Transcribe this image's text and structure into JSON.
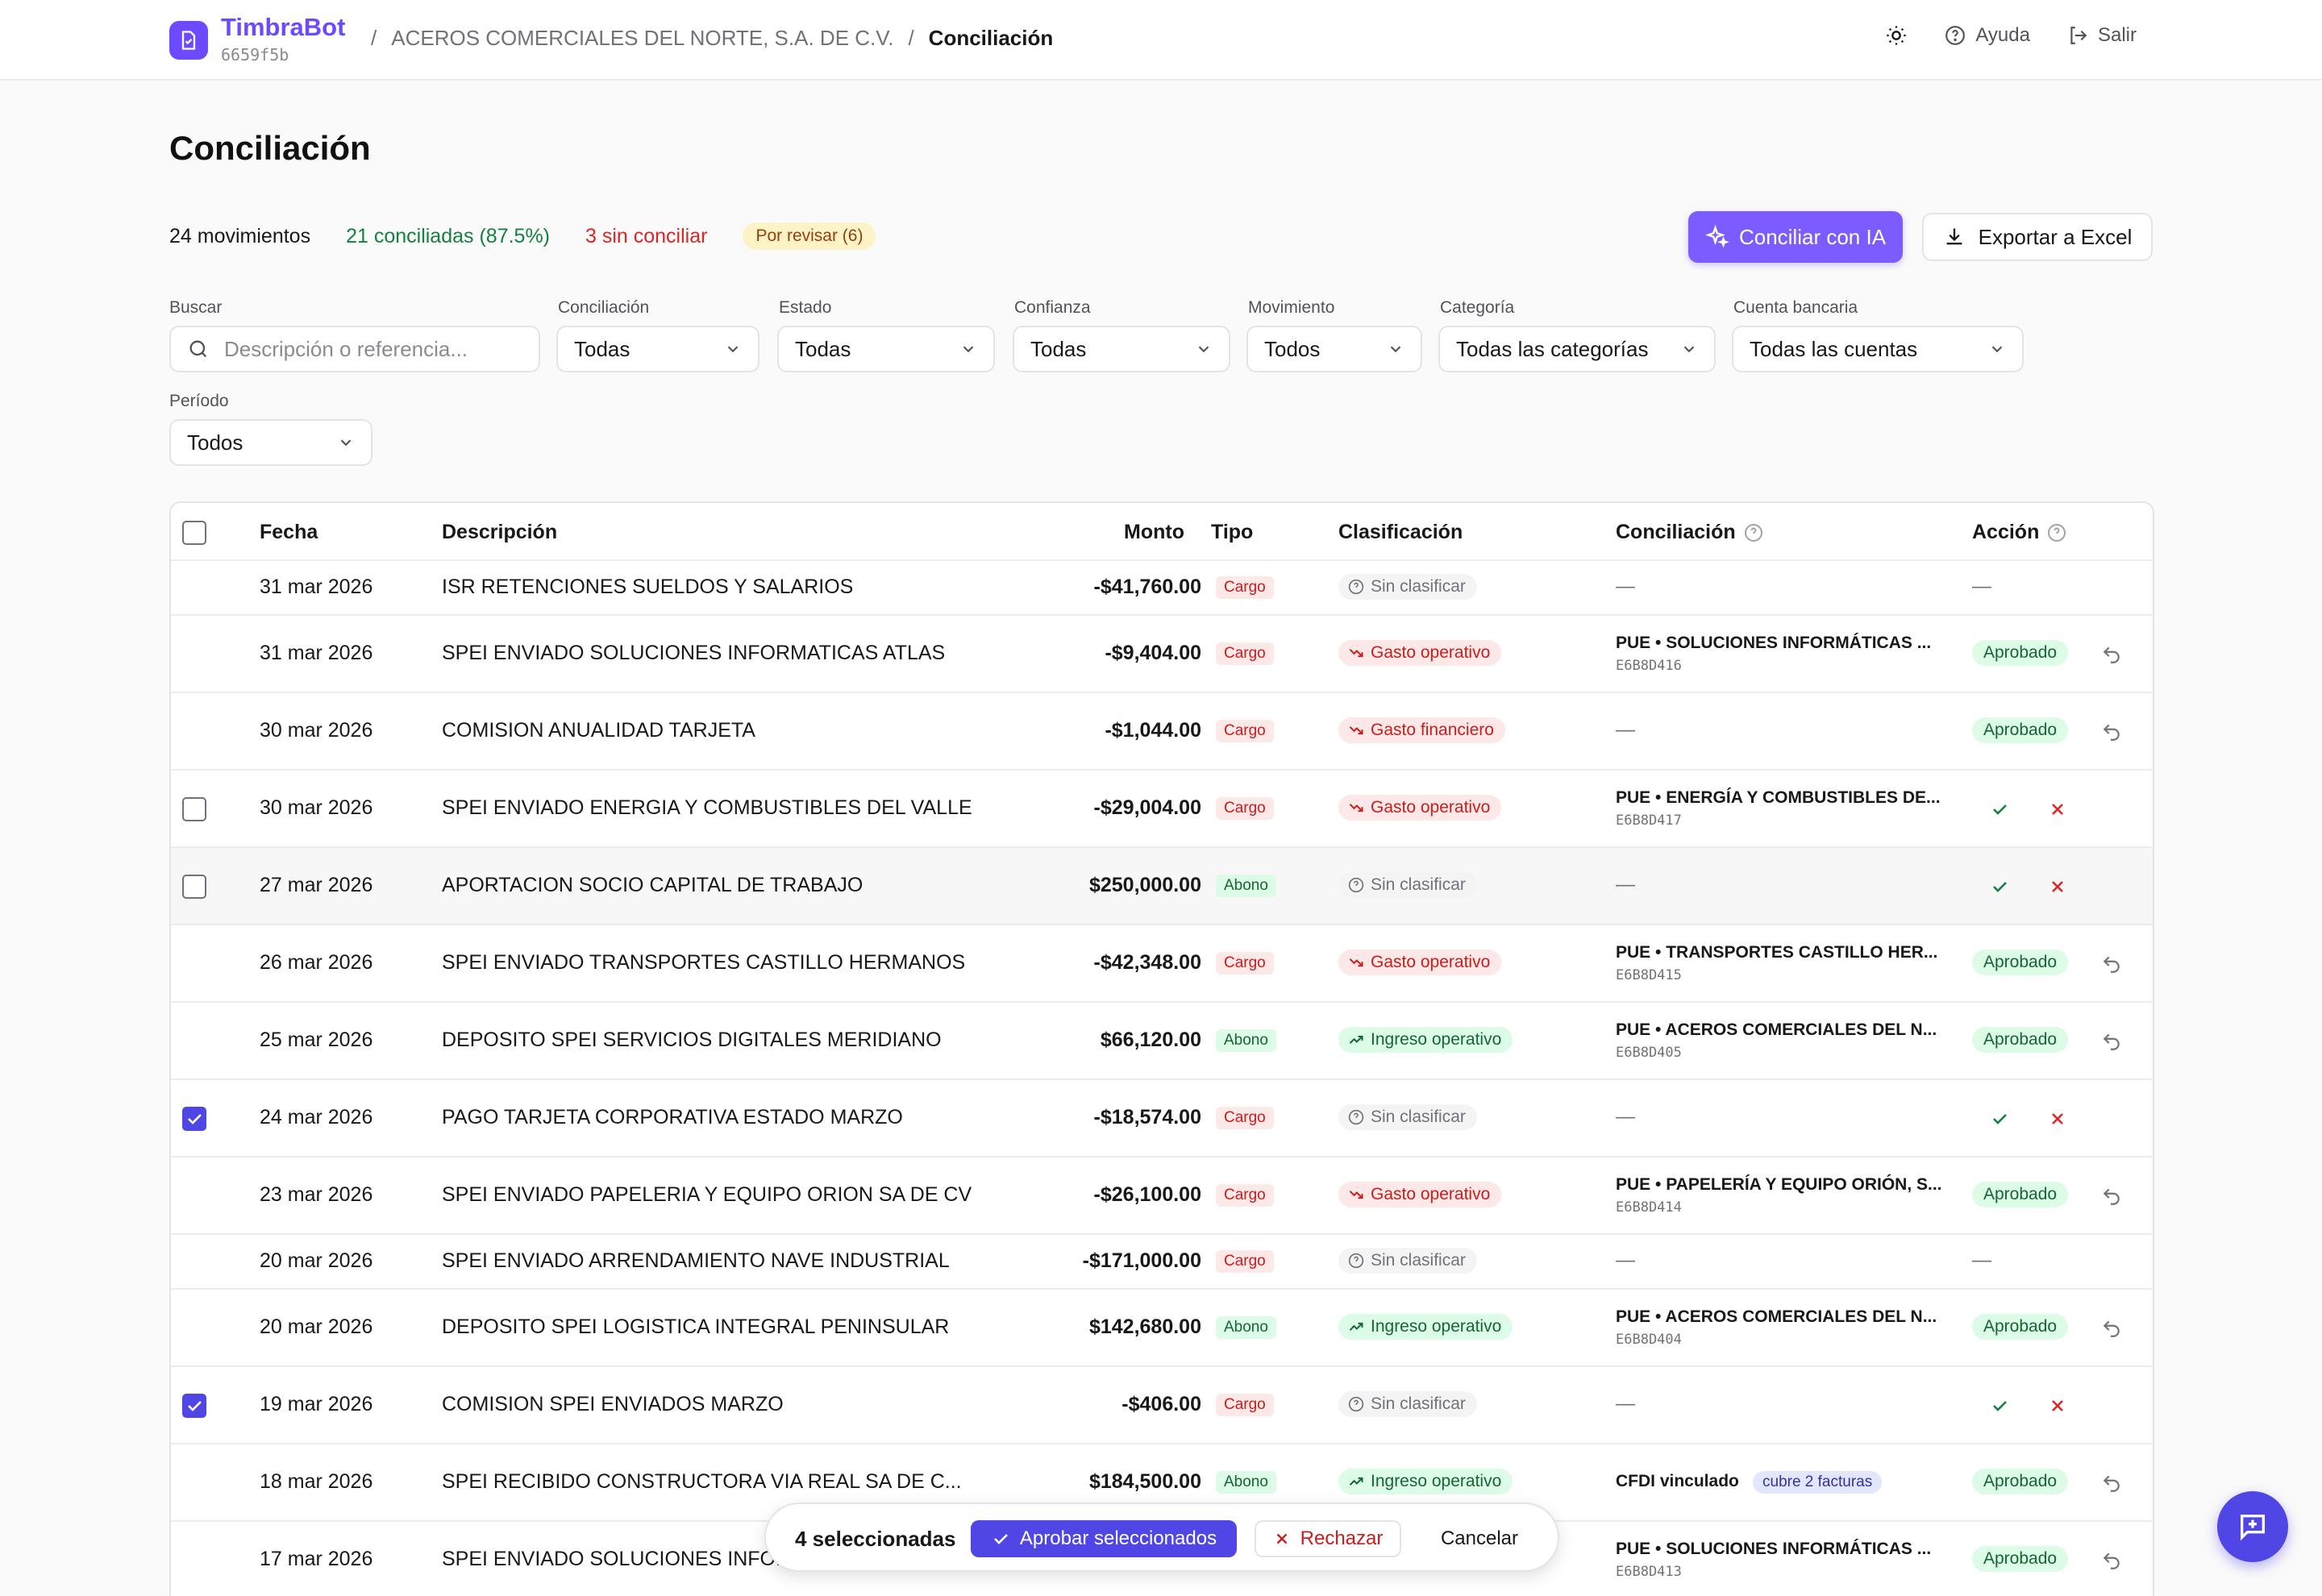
{
  "header": {
    "brand": "TimbraBot",
    "brand_id": "6659f5b",
    "crumb_sep": "/",
    "crumb_company": "ACEROS COMERCIALES DEL NORTE, S.A. DE C.V.",
    "crumb_current": "Conciliación",
    "help_label": "Ayuda",
    "logout_label": "Salir"
  },
  "page": {
    "title": "Conciliación"
  },
  "stats": {
    "movimientos": "24 movimientos",
    "conciliadas": "21 conciliadas (87.5%)",
    "sin_conciliar": "3 sin conciliar",
    "por_revisar": "Por revisar (6)"
  },
  "actions": {
    "ai_button": "Conciliar con IA",
    "excel_button": "Exportar a Excel"
  },
  "filters": {
    "search_label": "Buscar",
    "search_placeholder": "Descripción o referencia...",
    "conciliacion_label": "Conciliación",
    "conciliacion_value": "Todas",
    "estado_label": "Estado",
    "estado_value": "Todas",
    "confianza_label": "Confianza",
    "confianza_value": "Todas",
    "movimiento_label": "Movimiento",
    "movimiento_value": "Todos",
    "categoria_label": "Categoría",
    "categoria_value": "Todas las categorías",
    "cuenta_label": "Cuenta bancaria",
    "cuenta_value": "Todas las cuentas",
    "periodo_label": "Período",
    "periodo_value": "Todos"
  },
  "table": {
    "headers": {
      "fecha": "Fecha",
      "descripcion": "Descripción",
      "monto": "Monto",
      "tipo": "Tipo",
      "clasificacion": "Clasificación",
      "conciliacion": "Conciliación",
      "accion": "Acción"
    },
    "rows": [
      {
        "fecha": "31 mar 2026",
        "desc": "ISR RETENCIONES SUELDOS Y SALARIOS",
        "monto": "-$41,760.00",
        "tipo": "Cargo",
        "clasif": "Sin clasificar",
        "conc": "—",
        "conc_id": "",
        "accion": "—"
      },
      {
        "fecha": "31 mar 2026",
        "desc": "SPEI ENVIADO SOLUCIONES INFORMATICAS ATLAS",
        "monto": "-$9,404.00",
        "tipo": "Cargo",
        "clasif": "Gasto operativo",
        "conc": "PUE • SOLUCIONES INFORMÁTICAS ...",
        "conc_id": "E6B8D416",
        "accion": "Aprobado"
      },
      {
        "fecha": "30 mar 2026",
        "desc": "COMISION ANUALIDAD TARJETA",
        "monto": "-$1,044.00",
        "tipo": "Cargo",
        "clasif": "Gasto financiero",
        "conc": "—",
        "conc_id": "",
        "accion": "Aprobado"
      },
      {
        "fecha": "30 mar 2026",
        "desc": "SPEI ENVIADO ENERGIA Y COMBUSTIBLES DEL VALLE",
        "monto": "-$29,004.00",
        "tipo": "Cargo",
        "clasif": "Gasto operativo",
        "conc": "PUE • ENERGÍA Y COMBUSTIBLES DE...",
        "conc_id": "E6B8D417",
        "accion": ""
      },
      {
        "fecha": "27 mar 2026",
        "desc": "APORTACION SOCIO CAPITAL DE TRABAJO",
        "monto": "$250,000.00",
        "tipo": "Abono",
        "clasif": "Sin clasificar",
        "conc": "—",
        "conc_id": "",
        "accion": ""
      },
      {
        "fecha": "26 mar 2026",
        "desc": "SPEI ENVIADO TRANSPORTES CASTILLO HERMANOS",
        "monto": "-$42,348.00",
        "tipo": "Cargo",
        "clasif": "Gasto operativo",
        "conc": "PUE • TRANSPORTES CASTILLO HER...",
        "conc_id": "E6B8D415",
        "accion": "Aprobado"
      },
      {
        "fecha": "25 mar 2026",
        "desc": "DEPOSITO SPEI SERVICIOS DIGITALES MERIDIANO",
        "monto": "$66,120.00",
        "tipo": "Abono",
        "clasif": "Ingreso operativo",
        "conc": "PUE • ACEROS COMERCIALES DEL N...",
        "conc_id": "E6B8D405",
        "accion": "Aprobado"
      },
      {
        "fecha": "24 mar 2026",
        "desc": "PAGO TARJETA CORPORATIVA ESTADO MARZO",
        "monto": "-$18,574.00",
        "tipo": "Cargo",
        "clasif": "Sin clasificar",
        "conc": "—",
        "conc_id": "",
        "accion": ""
      },
      {
        "fecha": "23 mar 2026",
        "desc": "SPEI ENVIADO PAPELERIA Y EQUIPO ORION SA DE CV",
        "monto": "-$26,100.00",
        "tipo": "Cargo",
        "clasif": "Gasto operativo",
        "conc": "PUE • PAPELERÍA Y EQUIPO ORIÓN, S...",
        "conc_id": "E6B8D414",
        "accion": "Aprobado"
      },
      {
        "fecha": "20 mar 2026",
        "desc": "SPEI ENVIADO ARRENDAMIENTO NAVE INDUSTRIAL",
        "monto": "-$171,000.00",
        "tipo": "Cargo",
        "clasif": "Sin clasificar",
        "conc": "—",
        "conc_id": "",
        "accion": "—"
      },
      {
        "fecha": "20 mar 2026",
        "desc": "DEPOSITO SPEI LOGISTICA INTEGRAL PENINSULAR",
        "monto": "$142,680.00",
        "tipo": "Abono",
        "clasif": "Ingreso operativo",
        "conc": "PUE • ACEROS COMERCIALES DEL N...",
        "conc_id": "E6B8D404",
        "accion": "Aprobado"
      },
      {
        "fecha": "19 mar 2026",
        "desc": "COMISION SPEI ENVIADOS MARZO",
        "monto": "-$406.00",
        "tipo": "Cargo",
        "clasif": "Sin clasificar",
        "conc": "—",
        "conc_id": "",
        "accion": ""
      },
      {
        "fecha": "18 mar 2026",
        "desc": "SPEI RECIBIDO CONSTRUCTORA VIA REAL SA DE C...",
        "monto": "$184,500.00",
        "tipo": "Abono",
        "clasif": "Ingreso operativo",
        "conc": "CFDI vinculado",
        "conc_tag": "cubre 2 facturas",
        "conc_id": "",
        "accion": "Aprobado"
      },
      {
        "fecha": "17 mar 2026",
        "desc": "SPEI ENVIADO SOLUCIONES INFORMATICAS ATLAS",
        "monto": "",
        "tipo": "",
        "clasif": "",
        "conc": "PUE • SOLUCIONES INFORMÁTICAS ...",
        "conc_id": "E6B8D413",
        "accion": "Aprobado"
      }
    ]
  },
  "selection_bar": {
    "count": "4 seleccionadas",
    "approve": "Aprobar seleccionados",
    "reject": "Rechazar",
    "cancel": "Cancelar"
  },
  "colors": {
    "brand": "#6d4aff",
    "primary": "#4f46e5",
    "success": "#15803d",
    "danger": "#dc2626"
  }
}
